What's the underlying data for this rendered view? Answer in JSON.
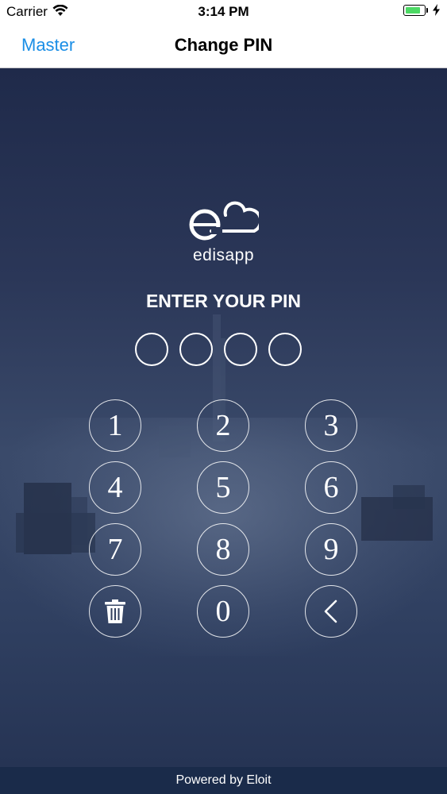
{
  "status_bar": {
    "carrier": "Carrier",
    "time": "3:14 PM",
    "battery_level": 0.85
  },
  "nav": {
    "back_label": "Master",
    "title": "Change PIN"
  },
  "logo": {
    "text": "edisapp"
  },
  "prompt": "ENTER YOUR PIN",
  "pin": {
    "length": 4,
    "filled": 0
  },
  "keypad": {
    "keys": [
      "1",
      "2",
      "3",
      "4",
      "5",
      "6",
      "7",
      "8",
      "9",
      "delete-icon",
      "0",
      "back-icon"
    ]
  },
  "footer": {
    "text": "Powered by Eloit"
  }
}
